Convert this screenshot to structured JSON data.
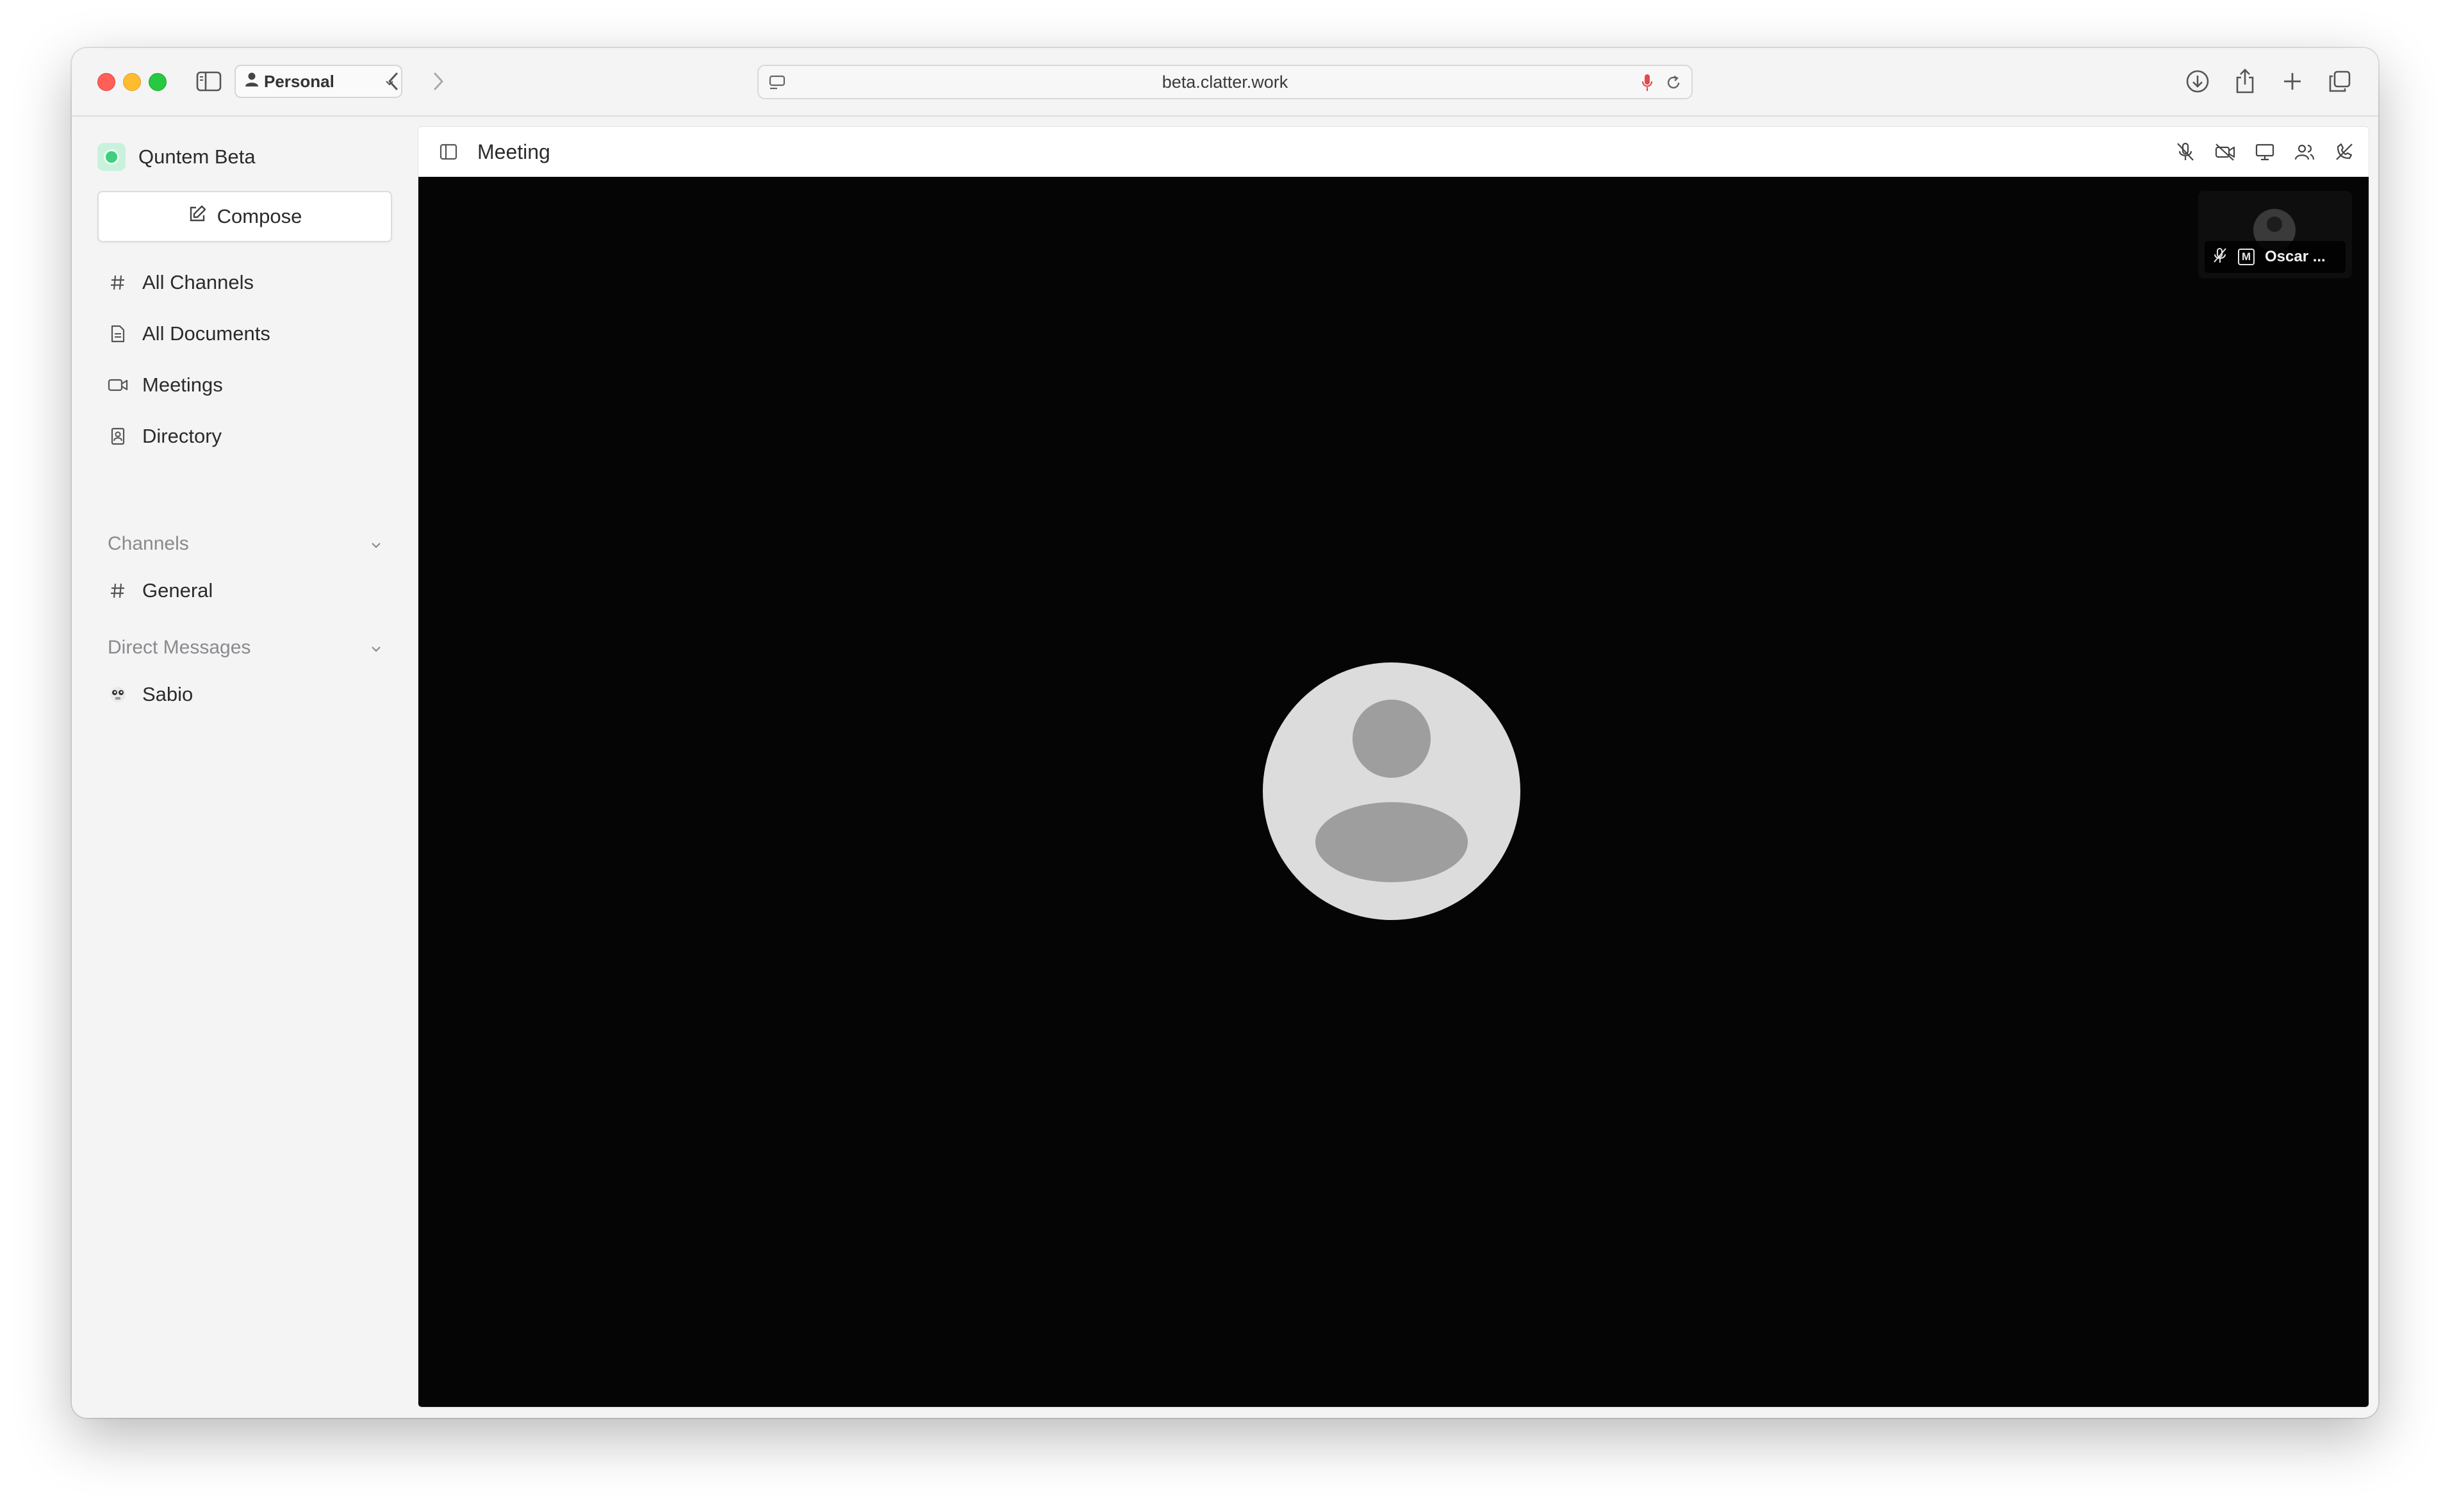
{
  "browser": {
    "profile_label": "Personal",
    "url": "beta.clatter.work",
    "icons": [
      "sidebar-toggle-icon",
      "back-arrow-icon",
      "forward-arrow-icon",
      "site-settings-icon",
      "microphone-icon",
      "reload-icon",
      "download-icon",
      "share-icon",
      "new-tab-icon",
      "tab-overview-icon"
    ]
  },
  "sidebar": {
    "workspace_name": "Quntem Beta",
    "compose_label": "Compose",
    "nav": [
      {
        "label": "All Channels",
        "icon": "hash-icon"
      },
      {
        "label": "All Documents",
        "icon": "document-icon"
      },
      {
        "label": "Meetings",
        "icon": "video-icon"
      },
      {
        "label": "Directory",
        "icon": "contacts-book-icon"
      }
    ],
    "channels_header": "Channels",
    "channels": [
      {
        "label": "General",
        "icon": "hash-icon"
      }
    ],
    "dm_header": "Direct Messages",
    "direct_messages": [
      {
        "label": "Sabio",
        "icon": "emoji-avatar-icon"
      }
    ]
  },
  "main": {
    "title": "Meeting",
    "header_icons": [
      "mic-off-icon",
      "camera-off-icon",
      "screen-share-icon",
      "participants-icon",
      "leave-call-icon"
    ],
    "participant_tile": {
      "badge": "M",
      "name": "Oscar ..."
    }
  },
  "colors": {
    "accent_green": "#3fcf7f",
    "stage_background": "#050505",
    "mic_red": "#e5484d"
  }
}
